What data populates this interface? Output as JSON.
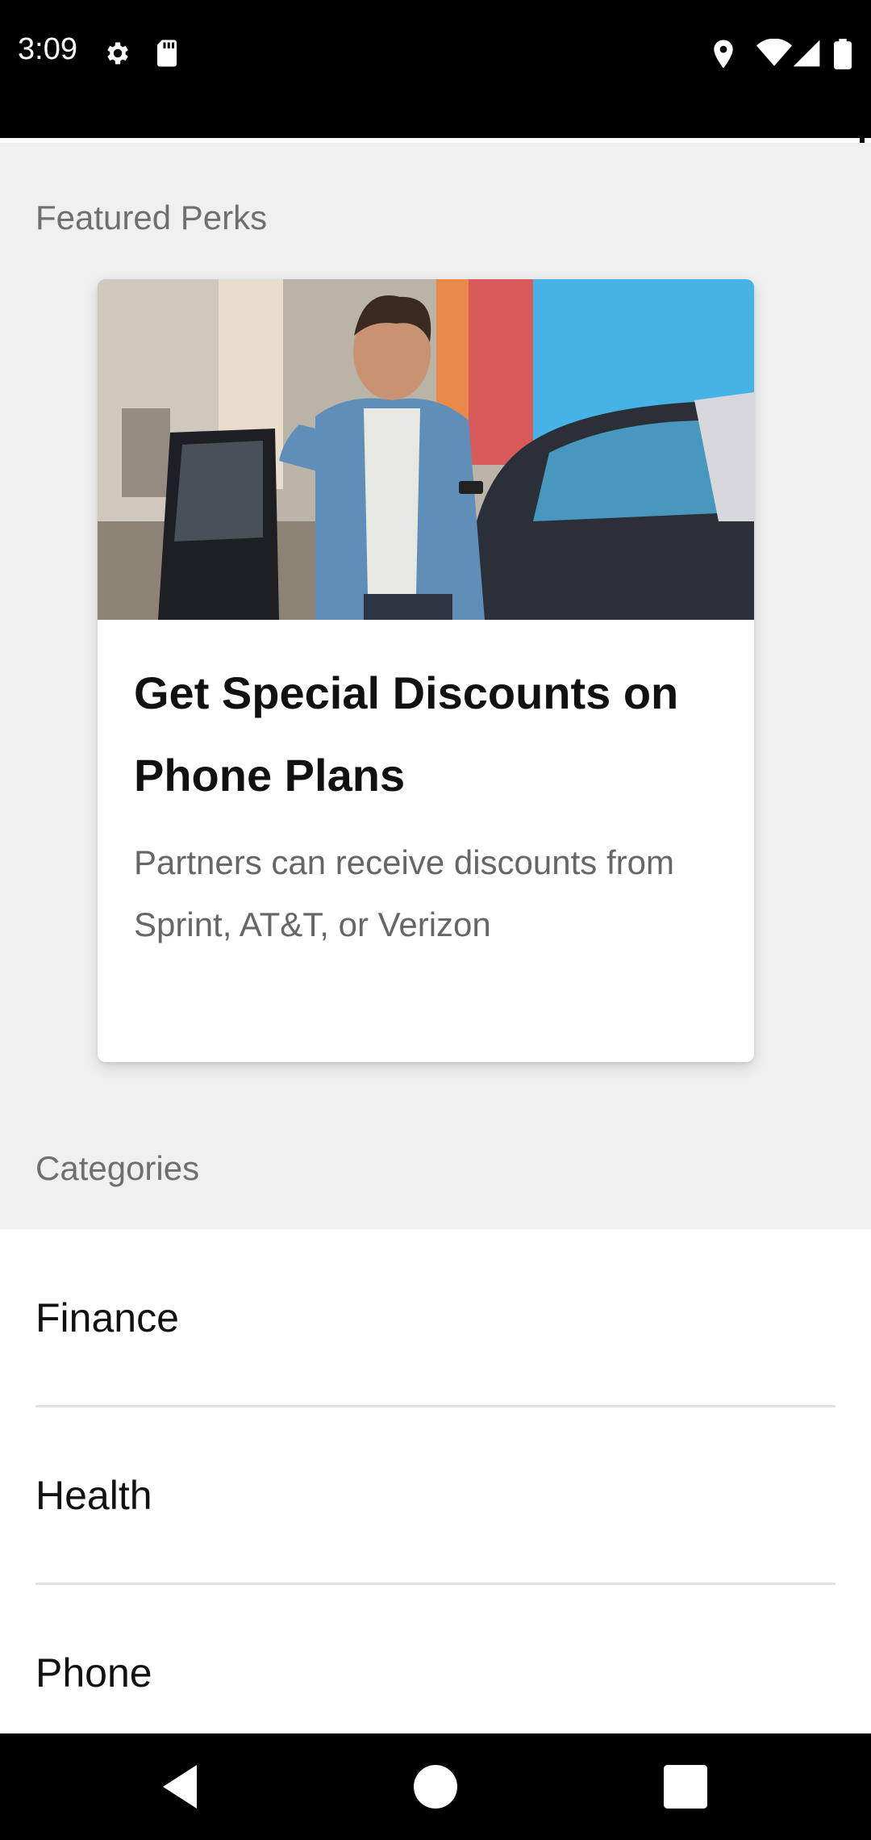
{
  "status_bar": {
    "time": "3:09",
    "left_icons": [
      "settings-icon",
      "sd-card-icon"
    ],
    "right_icons": [
      "location-icon",
      "wifi-icon",
      "cell-signal-icon",
      "battery-icon"
    ]
  },
  "featured": {
    "heading": "Featured Perks",
    "card": {
      "image": "man-leaning-on-car-with-phone",
      "title": "Get Special Discounts on Phone Plans",
      "description": "Partners can receive discounts from Sprint, AT&T, or Verizon"
    }
  },
  "categories": {
    "heading": "Categories",
    "items": [
      {
        "label": "Finance"
      },
      {
        "label": "Health"
      },
      {
        "label": "Phone"
      }
    ]
  },
  "nav_bar": {
    "buttons": [
      "back-icon",
      "home-icon",
      "recents-icon"
    ]
  }
}
